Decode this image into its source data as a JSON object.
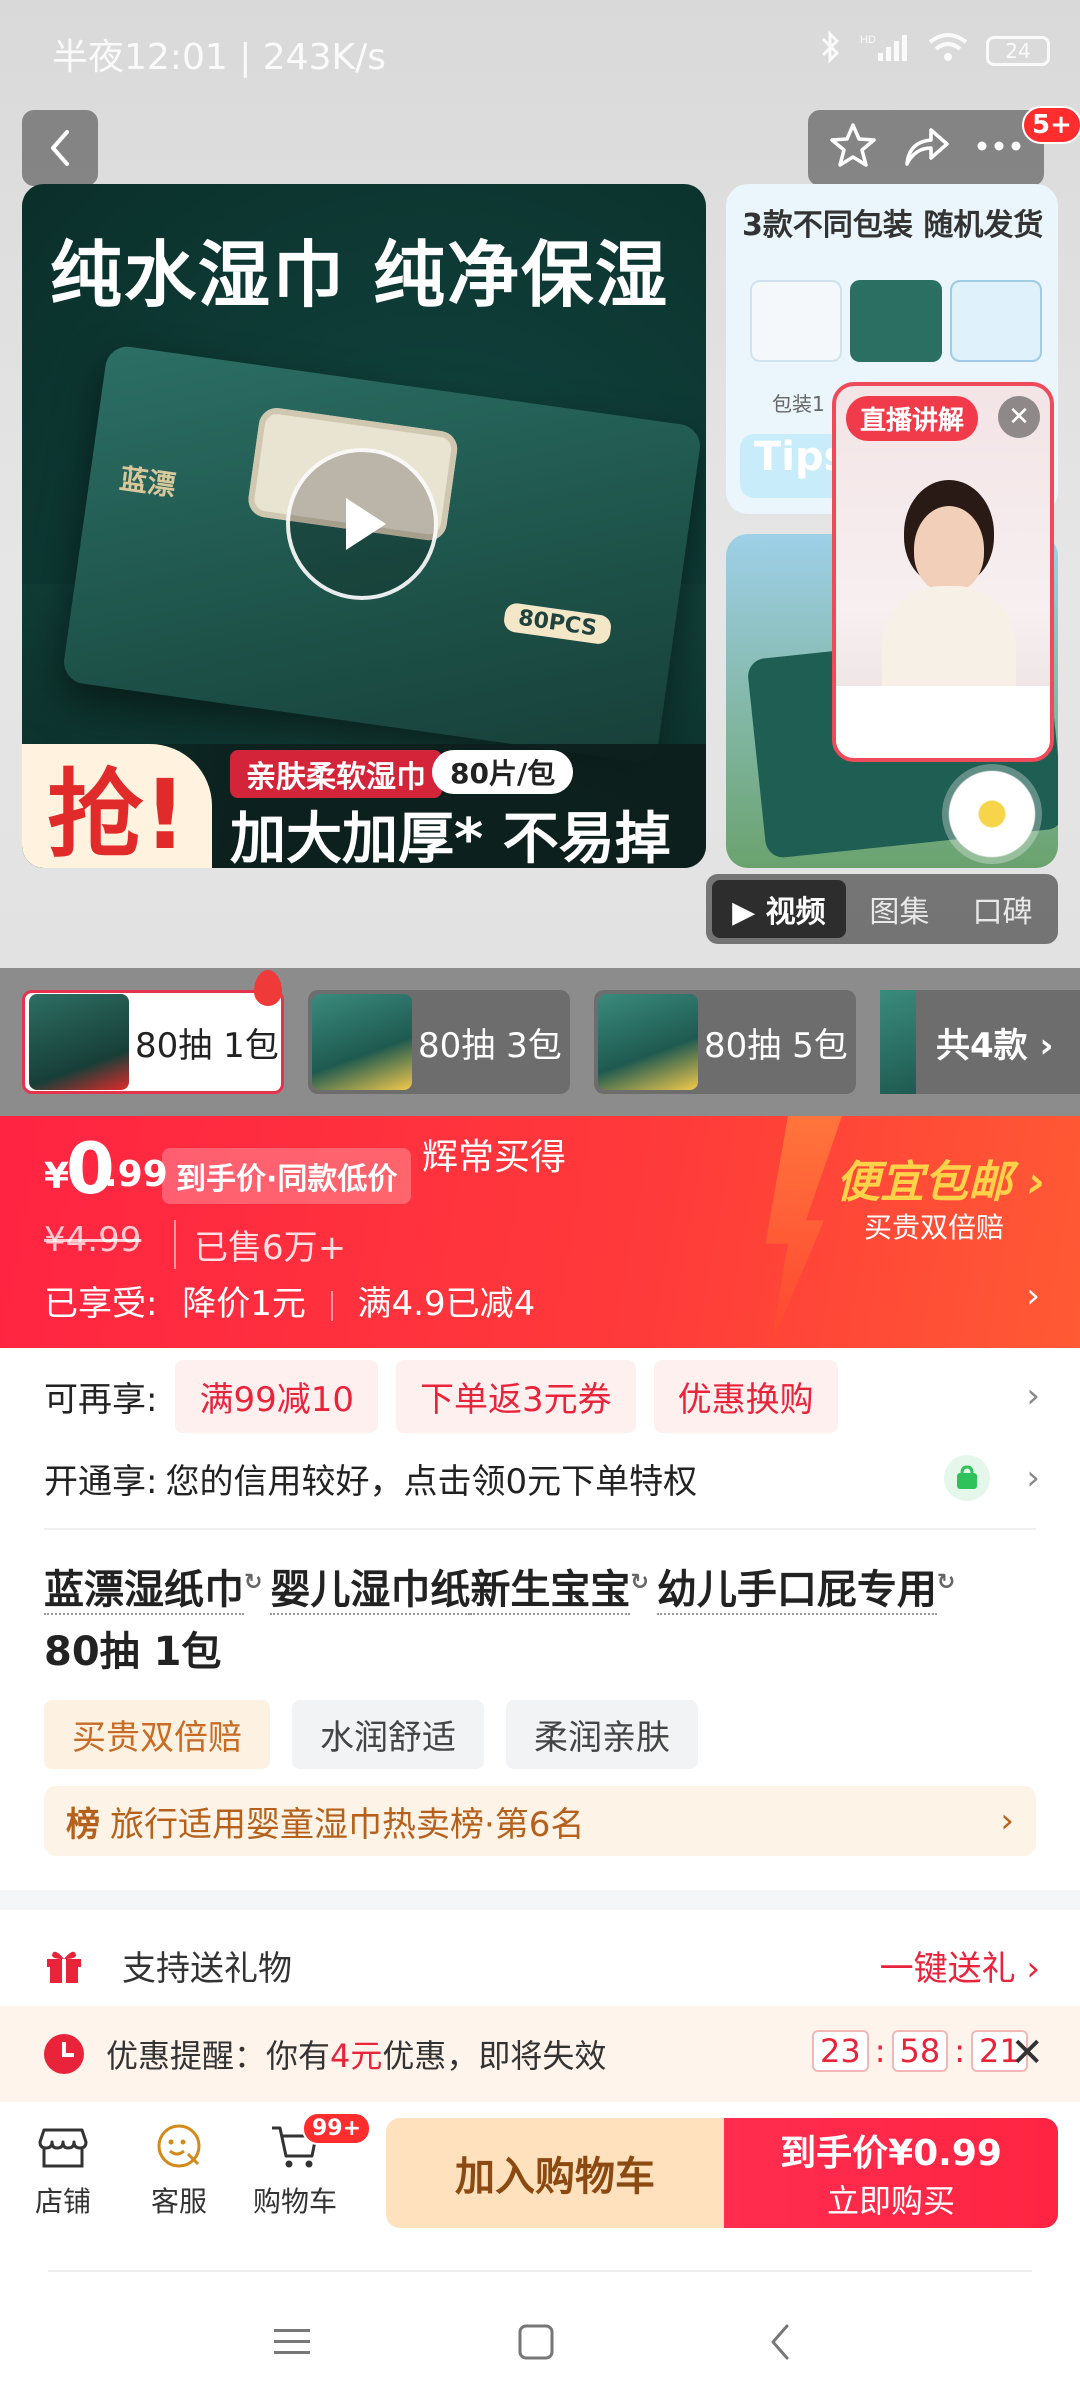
{
  "status_bar": {
    "time_speed": "半夜12:01 | 243K/s",
    "battery": "24"
  },
  "header": {
    "cart_badge": "5+"
  },
  "gallery": {
    "main_headline": "纯水湿巾 纯净保湿",
    "box_brand": "蓝漂",
    "box_count": "80PCS",
    "qiang": "抢!",
    "sub_label": "亲肤柔软湿巾",
    "sub_count": "80片/包",
    "sub_main": "加大加厚* 不易掉絮",
    "side1_title": "3款不同包装 随机发货",
    "side1_tips": "Tips",
    "side1_pack_label": "包装1",
    "live_tag": "直播讲解",
    "media_tabs": [
      "▶ 视频",
      "图集",
      "口碑"
    ]
  },
  "sku": {
    "items": [
      "80抽 1包",
      "80抽 3包",
      "80抽 5包"
    ],
    "more": "共4款 ›"
  },
  "price": {
    "symbol": "¥",
    "main": "0",
    "decimal": ".99",
    "tag": "到手价·同款低价",
    "slogan": "辉常买得",
    "original": "¥4.99",
    "sold": "已售6万+",
    "enjoy_label": "已享受:",
    "enjoy_1": "降价1元",
    "enjoy_2": "满4.9已减4",
    "promo_title": "便宜包邮 ›",
    "promo_sub": "买贵双倍赔"
  },
  "offers": {
    "label": "可再享:",
    "coupons": [
      "满99减10",
      "下单返3元券",
      "优惠换购"
    ],
    "credit_label": "开通享:",
    "credit_text": "您的信用较好，点击领0元下单特权"
  },
  "product": {
    "title_kw1": "蓝漂湿纸巾",
    "title_kw2": "婴儿湿巾纸",
    "title_kw3": "新生宝宝",
    "title_kw4": "幼儿手口屁专用",
    "title_tail": "80抽 1包",
    "tags": [
      "买贵双倍赔",
      "水润舒适",
      "柔润亲肤"
    ],
    "rank_icon": "榜",
    "rank_text": "旅行适用婴童湿巾热卖榜·第6名"
  },
  "gift": {
    "label": "支持送礼物",
    "action": "一键送礼 ›"
  },
  "reminder": {
    "prefix": "优惠提醒：你有",
    "amount": "4元",
    "suffix": "优惠，即将失效",
    "hh": "23",
    "mm": "58",
    "ss": "21"
  },
  "bottom_bar": {
    "shop": "店铺",
    "service": "客服",
    "cart": "购物车",
    "cart_badge": "99+",
    "add_cart": "加入购物车",
    "buy_line1": "到手价¥0.99",
    "buy_line2": "立即购买"
  },
  "colors": {
    "accent": "#ff2442",
    "gold": "#ffd24a"
  }
}
